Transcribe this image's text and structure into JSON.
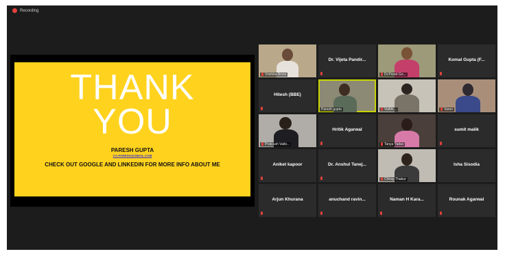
{
  "recording": {
    "label": "Recording"
  },
  "slide": {
    "line1": "THANK",
    "line2": "YOU",
    "name": "PARESH GUPTA",
    "email": "CA.PARESH@GMAIL.COM",
    "cta": "CHECK OUT GOOGLE AND LINKEDIN FOR MORE INFO ABOUT ME"
  },
  "participants": [
    {
      "name": "Vrishika Arora"
    },
    {
      "name": "Dr. Vijeta Pandir..."
    },
    {
      "name": "Dr.Preeti Go..."
    },
    {
      "name": "Komal Gupta (F..."
    },
    {
      "name": "Hitesh (BBE)"
    },
    {
      "name": "Paresh gupta"
    },
    {
      "name": "Vaibhi..."
    },
    {
      "name": "Varun"
    },
    {
      "name": "Pratyush Vaibi..."
    },
    {
      "name": "Hritik Agarwal"
    },
    {
      "name": "Tanya Yadav"
    },
    {
      "name": "sumit malik"
    },
    {
      "name": "Aniket kapoor"
    },
    {
      "name": "Dr. Anshul Tanej..."
    },
    {
      "name": "Chirag Thakur"
    },
    {
      "name": "Isha Sisodia"
    },
    {
      "name": "Arjun Khurana"
    },
    {
      "name": "anuchand ravin..."
    },
    {
      "name": "Naman H Kara..."
    },
    {
      "name": "Rounak Agarwal"
    }
  ],
  "colors": {
    "slide_bg": "#ffd21e",
    "window_bg": "#1c1c1c",
    "tile_bg": "#2b2b2b",
    "active_speaker": "#c9d400",
    "muted": "#e0413a"
  }
}
